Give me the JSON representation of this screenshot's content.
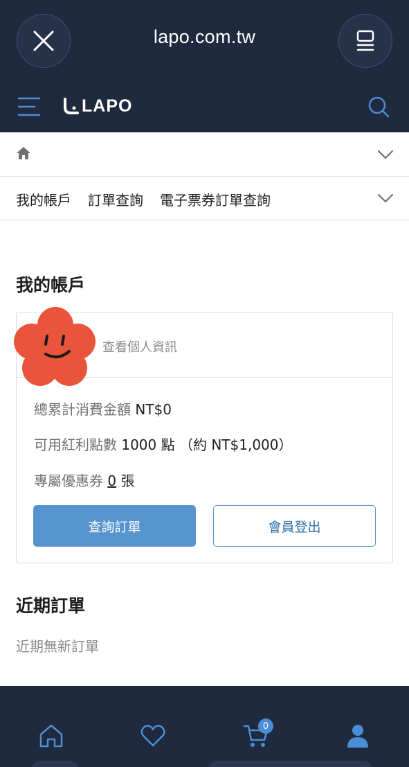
{
  "browser": {
    "url": "lapo.com.tw",
    "close_icon": "close-icon",
    "tabs_icon": "tabs-icon"
  },
  "header": {
    "logo_text": "LAPO",
    "menu_icon": "hamburger-menu-icon",
    "search_icon": "search-icon"
  },
  "breadcrumb": {
    "home_icon": "home-icon",
    "tabs": [
      "我的帳戶",
      "訂單查詢",
      "電子票券訂單查詢"
    ]
  },
  "account": {
    "title": "我的帳戶",
    "profile_link": "查看個人資訊",
    "total_spent_label": "總累計消費金額",
    "total_spent_value": "NT$0",
    "points_label": "可用紅利點數",
    "points_value": "1000 點",
    "points_equiv": "（約 NT$1,000）",
    "coupons_label": "專屬優惠券",
    "coupons_count": "0",
    "coupons_unit": "張",
    "query_orders_button": "查詢訂單",
    "logout_button": "會員登出"
  },
  "recent_orders": {
    "title": "近期訂單",
    "empty_text": "近期無新訂單"
  },
  "bottom_nav": {
    "cart_count": "0",
    "items": [
      "home-icon",
      "heart-icon",
      "cart-icon",
      "user-icon"
    ]
  },
  "colors": {
    "dark_navy": "#1f2a3e",
    "accent_blue": "#5794cf",
    "avatar_orange": "#e8553a"
  }
}
